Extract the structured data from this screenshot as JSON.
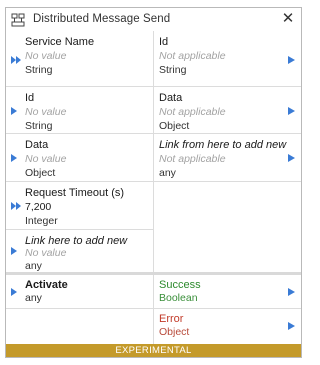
{
  "block": {
    "title": "Distributed Message Send",
    "icon": "distributed-message-icon",
    "close_label": "✕",
    "footer": "EXPERIMENTAL"
  },
  "inputs": [
    {
      "label": "Service Name",
      "value": "No value",
      "type": "String",
      "port": "multi-input-port"
    },
    {
      "label": "Id",
      "value": "No value",
      "type": "String",
      "port": "input-port"
    },
    {
      "label": "Data",
      "value": "No value",
      "type": "Object",
      "port": "input-port"
    },
    {
      "label": "Request Timeout (s)",
      "value": "7,200",
      "type": "Integer",
      "port": "multi-input-port"
    },
    {
      "label": "Link here to add new",
      "value": "No value",
      "type": "any",
      "port": "input-port"
    }
  ],
  "outputs": [
    {
      "label": "Id",
      "value": "Not applicable",
      "type": "String"
    },
    {
      "label": "Data",
      "value": "Not applicable",
      "type": "Object"
    },
    {
      "label": "Link from here to add new",
      "value": "Not applicable",
      "type": "any"
    }
  ],
  "control_in": {
    "label": "Activate",
    "type": "any"
  },
  "control_out": [
    {
      "label": "Success",
      "type": "Boolean",
      "color": "#2c8a2c"
    },
    {
      "label": "Error",
      "type": "Object",
      "color": "#c23b2a"
    }
  ],
  "colors": {
    "accent_port": "#3a7bd5",
    "footer_bg": "#c49a2a",
    "border": "#b9b9b9"
  }
}
